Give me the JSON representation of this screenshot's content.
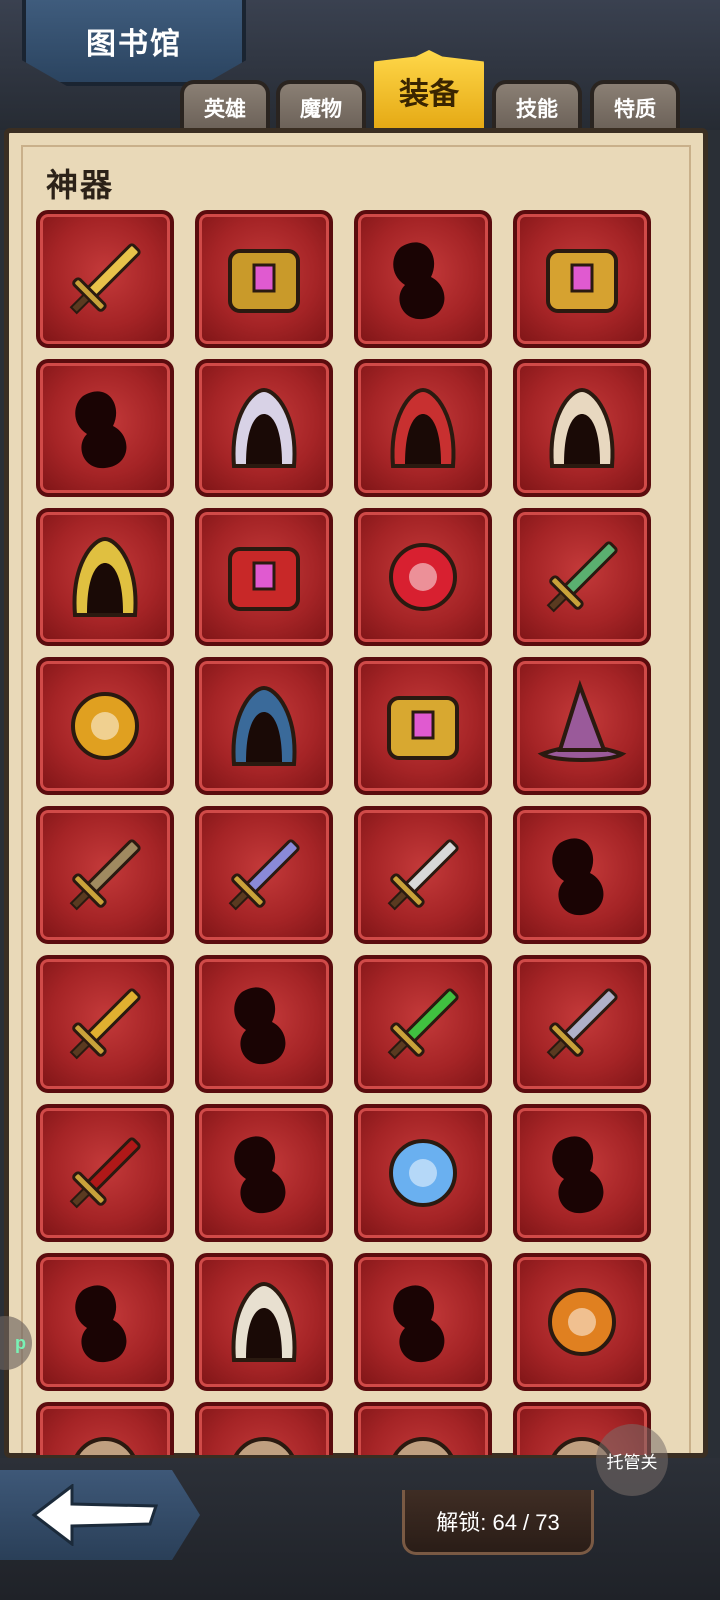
{
  "header": {
    "title": "图书馆"
  },
  "tabs": [
    {
      "label": "英雄",
      "active": false
    },
    {
      "label": "魔物",
      "active": false
    },
    {
      "label": "装备",
      "active": true
    },
    {
      "label": "技能",
      "active": false
    },
    {
      "label": "特质",
      "active": false
    }
  ],
  "section": {
    "title": "神器"
  },
  "items": [
    {
      "name": "winged-holy-scepter",
      "unlocked": true
    },
    {
      "name": "golden-backpack",
      "unlocked": true
    },
    {
      "name": "unknown-armor",
      "unlocked": false
    },
    {
      "name": "thunder-shield",
      "unlocked": true
    },
    {
      "name": "unknown-vase",
      "unlocked": false
    },
    {
      "name": "golden-hood",
      "unlocked": true
    },
    {
      "name": "royal-fur-cape",
      "unlocked": true
    },
    {
      "name": "jeweled-robe",
      "unlocked": true
    },
    {
      "name": "winged-helmet",
      "unlocked": true
    },
    {
      "name": "gem-tome",
      "unlocked": true
    },
    {
      "name": "ruby-necklace",
      "unlocked": true
    },
    {
      "name": "emerald-cross-staff",
      "unlocked": true
    },
    {
      "name": "gem-crown-ring",
      "unlocked": true
    },
    {
      "name": "lightning-gauntlet",
      "unlocked": true
    },
    {
      "name": "golden-bracers",
      "unlocked": true
    },
    {
      "name": "wizard-hat",
      "unlocked": true
    },
    {
      "name": "war-hammer",
      "unlocked": true
    },
    {
      "name": "crystal-sword",
      "unlocked": true
    },
    {
      "name": "poison-dagger",
      "unlocked": true
    },
    {
      "name": "unknown-blade",
      "unlocked": false
    },
    {
      "name": "storm-spear",
      "unlocked": true
    },
    {
      "name": "unknown-axe",
      "unlocked": false
    },
    {
      "name": "venom-blade",
      "unlocked": true
    },
    {
      "name": "shadow-scythe",
      "unlocked": true
    },
    {
      "name": "blood-greatsword",
      "unlocked": true
    },
    {
      "name": "unknown-staff",
      "unlocked": false
    },
    {
      "name": "arcane-orb",
      "unlocked": true
    },
    {
      "name": "unknown-ring",
      "unlocked": false
    },
    {
      "name": "unknown-heart",
      "unlocked": false
    },
    {
      "name": "war-horn",
      "unlocked": true
    },
    {
      "name": "unknown-book",
      "unlocked": false
    },
    {
      "name": "pumpkin-ring",
      "unlocked": true
    },
    {
      "name": "partial-1",
      "unlocked": true
    },
    {
      "name": "partial-2",
      "unlocked": true
    },
    {
      "name": "partial-3",
      "unlocked": true
    },
    {
      "name": "partial-4",
      "unlocked": true
    }
  ],
  "footer": {
    "unlock_label": "解锁: 64 / 73",
    "auto_label": "托管关",
    "side_label": "p"
  },
  "colors": {
    "active_tab": "#f5c52a",
    "cell_red": "#a52426",
    "panel": "#e9d9b8"
  }
}
